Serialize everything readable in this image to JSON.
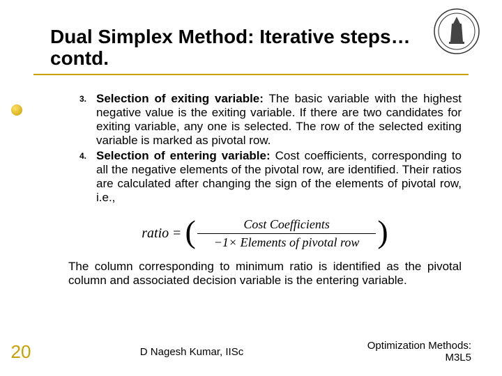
{
  "title": "Dual Simplex Method: Iterative steps…contd.",
  "items": [
    {
      "num": "3.",
      "bold": "Selection of exiting variable:",
      "text": " The basic variable with the highest negative value is the exiting variable. If there are two candidates for exiting variable, any one is selected. The row of the selected exiting variable is marked as pivotal row."
    },
    {
      "num": "4.",
      "bold": "Selection of entering variable:",
      "text": " Cost coefficients, corresponding to all the negative elements of the pivotal row, are identified. Their ratios are calculated after changing the sign of the elements of pivotal row, i.e.,"
    }
  ],
  "formula": {
    "lhs": "ratio",
    "eq": "=",
    "numerator": "Cost Coefficients",
    "denominator": "−1× Elements of pivotal row"
  },
  "closing": "The column corresponding to minimum ratio is identified as the pivotal column and associated decision variable is the entering variable.",
  "footer": {
    "slide_num": "20",
    "center": "D Nagesh Kumar, IISc",
    "right": "Optimization Methods: M3L5"
  }
}
